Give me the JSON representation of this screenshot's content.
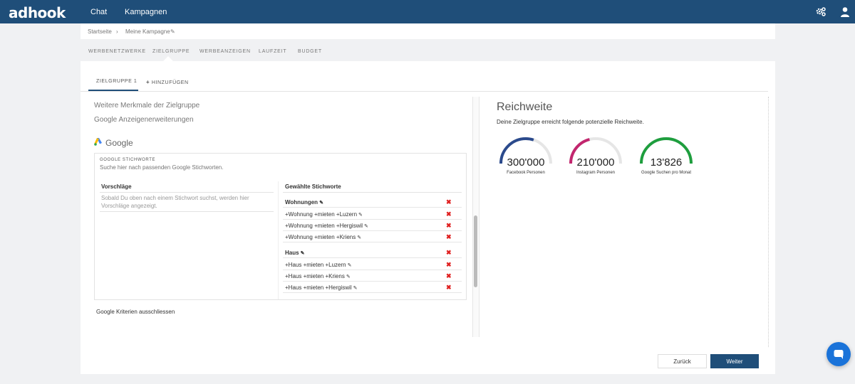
{
  "app": {
    "logo": "adhook"
  },
  "topnav": {
    "items": [
      "Chat",
      "Kampagnen"
    ],
    "settings_icon": "gears-icon",
    "user_icon": "user-icon"
  },
  "breadcrumb": {
    "home": "Startseite",
    "separator": "›",
    "current": "Meine Kampagne"
  },
  "tabs": [
    "WERBENETZWERKE",
    "ZIELGRUPPE",
    "WERBEANZEIGEN",
    "LAUFZEIT",
    "BUDGET"
  ],
  "active_tab": "ZIELGRUPPE",
  "subtabs": {
    "active": "ZIELGRUPPE 1",
    "add": "HINZUFÜGEN"
  },
  "links": {
    "more_features": "Weitere Merkmale der Zielgruppe",
    "extensions": "Google Anzeigenerweiterungen",
    "exclude": "Google Kriterien ausschliessen"
  },
  "google": {
    "title": "Google",
    "keywords_label": "GOOGLE STICHWORTE",
    "keywords_placeholder": "Suche hier nach passenden Google Stichworten.",
    "suggestions_header": "Vorschläge",
    "suggestions_hint": "Sobald Du oben nach einem Stichwort suchst, werden hier Vorschläge angezeigt.",
    "selected_header": "Gewählte Stichworte",
    "groups": [
      {
        "name": "Wohnungen",
        "keywords": [
          "+Wohnung +mieten +Luzern",
          "+Wohnung +mieten +Hergiswil",
          "+Wohnung +mieten +Kriens"
        ]
      },
      {
        "name": "Haus",
        "keywords": [
          "+Haus +mieten +Luzern",
          "+Haus +mieten +Kriens",
          "+Haus +mieten +Hergiswil"
        ]
      }
    ],
    "delete_symbol": "✖"
  },
  "reach": {
    "title": "Reichweite",
    "subtitle": "Deine Zielgruppe erreicht folgende potenzielle Reichweite.",
    "gauges": [
      {
        "value": "300'000",
        "label": "Facebook Personen",
        "color": "#2b4a8c",
        "fill": 0.6
      },
      {
        "value": "210'000",
        "label": "Instagram Personen",
        "color": "#c2266e",
        "fill": 0.42
      },
      {
        "value": "13'826",
        "label": "Google Suchen pro Monat",
        "color": "#1e9e3e",
        "fill": 1.0
      }
    ]
  },
  "buttons": {
    "back": "Zurück",
    "next": "Weiter"
  },
  "colors": {
    "header": "#1f4e79",
    "accent": "#1a73d9",
    "delete": "#e02020"
  }
}
